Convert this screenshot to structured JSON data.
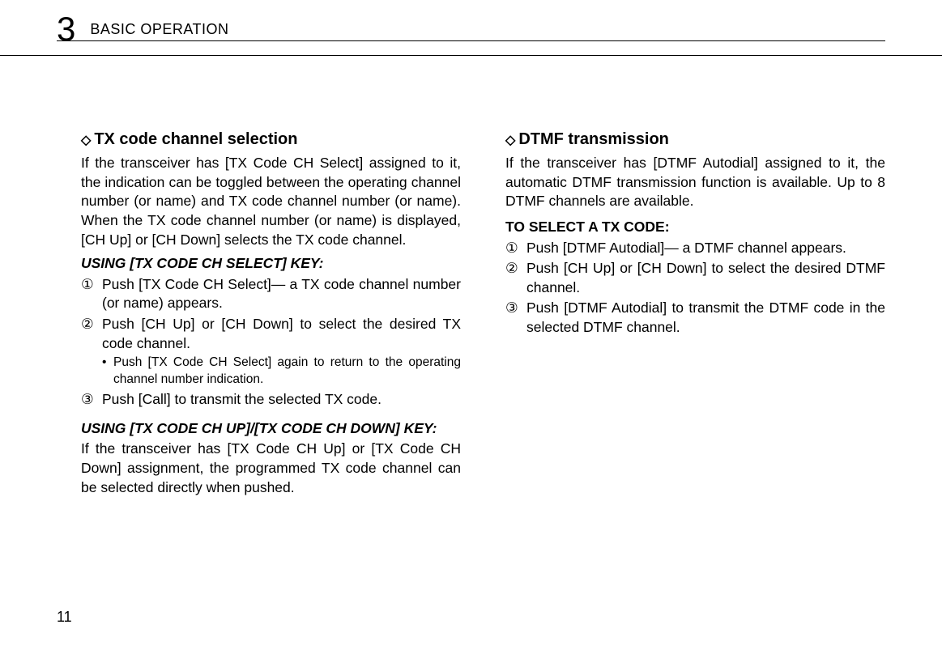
{
  "header": {
    "chapter_num": "3",
    "chapter_title": "BASIC OPERATION"
  },
  "left_column": {
    "section1": {
      "heading": "TX code channel selection",
      "diamond": "◇",
      "intro": "If the transceiver has [TX Code CH Select] assigned to it, the indication can be toggled between the operating channel number (or name) and TX code channel number (or name). When the TX code channel number (or name) is displayed, [CH Up] or [CH Down] selects the TX code channel.",
      "subheading1": "USING [TX CODE CH SELECT] KEY:",
      "step1_marker": "①",
      "step1": "Push [TX Code CH Select]— a TX code channel number (or name) appears.",
      "step2_marker": "②",
      "step2": "Push [CH Up] or [CH Down] to select the desired TX code channel.",
      "bullet_marker": "•",
      "bullet": "Push [TX Code CH Select] again to return to the operating channel number indication.",
      "step3_marker": "③",
      "step3": "Push [Call] to transmit the selected TX code.",
      "subheading2": "USING [TX CODE CH UP]/[TX CODE CH DOWN] KEY:",
      "para2": "If the transceiver has [TX Code CH Up] or [TX Code CH Down] assignment, the programmed TX code channel can be selected directly when pushed."
    }
  },
  "right_column": {
    "section1": {
      "heading": "DTMF transmission",
      "diamond": "◇",
      "intro": "If the transceiver has [DTMF Autodial] assigned to it, the automatic DTMF transmission function is available. Up to 8 DTMF channels are available.",
      "boldheading": "TO SELECT A TX CODE:",
      "step1_marker": "①",
      "step1": "Push [DTMF Autodial]— a DTMF channel appears.",
      "step2_marker": "②",
      "step2": "Push [CH Up] or [CH Down] to select the desired DTMF channel.",
      "step3_marker": "③",
      "step3": "Push [DTMF Autodial] to transmit the DTMF code in the selected DTMF channel."
    }
  },
  "page_num": "11"
}
